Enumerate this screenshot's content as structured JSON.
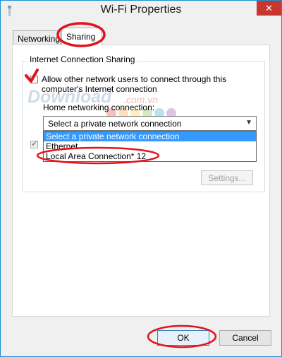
{
  "window": {
    "title": "Wi-Fi Properties",
    "close_glyph": "✕"
  },
  "tabs": [
    {
      "label": "Networking"
    },
    {
      "label": "Sharing"
    }
  ],
  "sharing": {
    "group_label": "Internet Connection Sharing",
    "allow_line1": "Allow other network users to connect through this",
    "allow_line2": "computer's Internet connection",
    "home_label": "Home networking connection:",
    "select_value": "Select a private network connection",
    "options": [
      "Select a private network connection",
      "Ethernet",
      "Local Area Connection* 12"
    ],
    "settings_label": "Settings..."
  },
  "footer": {
    "ok_label": "OK",
    "cancel_label": "Cancel"
  },
  "watermark": {
    "main": "Download",
    "sub": ".com.vn"
  },
  "colors": {
    "annotation": "#e3121b",
    "selection": "#3399ff",
    "close": "#c7372f"
  },
  "icons": {
    "dropdown": "chevron-down-icon",
    "window": "wifi-app-icon",
    "check": "checkmark-icon"
  }
}
